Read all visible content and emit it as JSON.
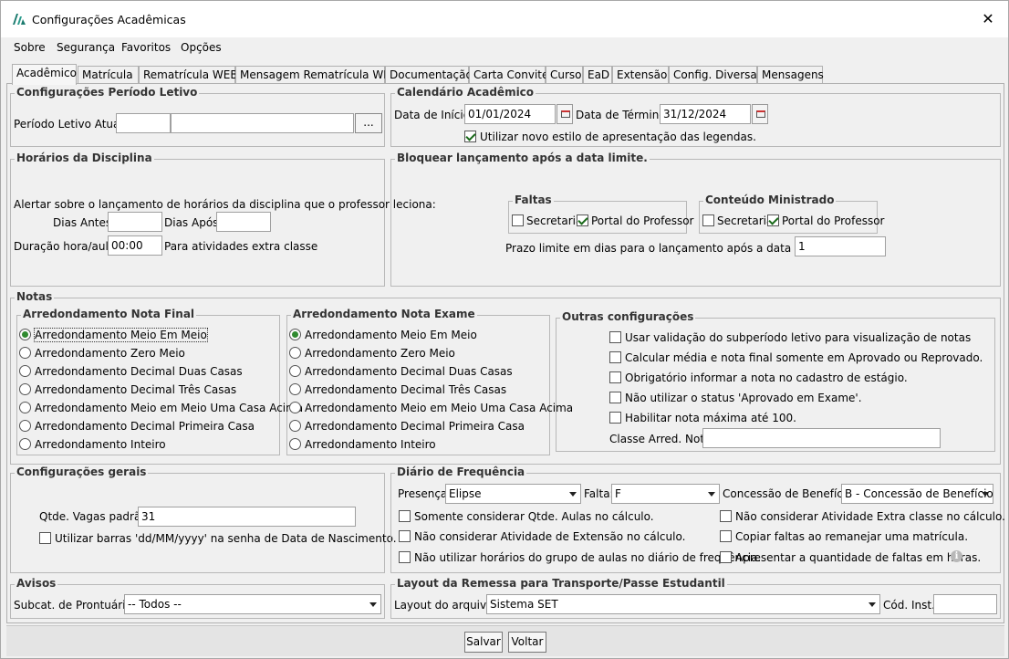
{
  "window": {
    "title": "Configurações Acadêmicas",
    "logo_icon": "app-logo-icon",
    "close_icon": "close-icon"
  },
  "menu": [
    "Sobre",
    "Segurança",
    "Favoritos",
    "Opções"
  ],
  "tabs": [
    "Acadêmico",
    "Matrícula",
    "Rematrícula WEB",
    "Mensagem Rematrícula WEB",
    "Documentação",
    "Carta Convite",
    "Curso",
    "EaD",
    "Extensão",
    "Config. Diversas",
    "Mensagens"
  ],
  "active_tab": "Acadêmico",
  "periodo": {
    "legend": "Configurações Período Letivo",
    "label": "Período Letivo Atual:",
    "code": "",
    "name": "",
    "browse": "..."
  },
  "calendario": {
    "legend": "Calendário Acadêmico",
    "inicio_label": "Data de Início:",
    "inicio": "01/01/2024",
    "termino_label": "Data de Término:",
    "termino": "31/12/2024",
    "novo_estilo": "Utilizar novo estilo de apresentação das legendas.",
    "novo_estilo_checked": true
  },
  "horarios": {
    "legend": "Horários da Disciplina",
    "alert": "Alertar sobre o lançamento de horários da disciplina que o professor leciona:",
    "dias_antes_label": "Dias Antes:",
    "dias_antes": "",
    "dias_apos_label": "Dias Após:",
    "dias_apos": "",
    "duracao_label": "Duração hora/aula:",
    "duracao": "00:00",
    "extra": "Para atividades extra classe"
  },
  "bloquear": {
    "legend": "Bloquear lançamento após a data limite.",
    "faltas_legend": "Faltas",
    "conteudo_legend": "Conteúdo Ministrado",
    "secretaria": "Secretaria",
    "portal": "Portal do Professor",
    "faltas_secretaria": false,
    "faltas_portal": true,
    "conteudo_secretaria": false,
    "conteudo_portal": true,
    "prazo_label": "Prazo limite em dias para o lançamento após a data da aula:",
    "prazo": "1"
  },
  "notas": {
    "legend": "Notas",
    "final_legend": "Arredondamento Nota Final",
    "exame_legend": "Arredondamento Nota Exame",
    "options": [
      "Arredondamento Meio Em Meio",
      "Arredondamento Zero Meio",
      "Arredondamento Decimal Duas Casas",
      "Arredondamento Decimal Três Casas",
      "Arredondamento Meio em Meio Uma Casa Acima",
      "Arredondamento Decimal Primeira Casa",
      "Arredondamento Inteiro"
    ],
    "final_selected": 0,
    "exame_selected": 0,
    "outras_legend": "Outras configurações",
    "outras": [
      "Usar validação do subperíodo letivo para visualização de notas",
      "Calcular média e nota final somente em Aprovado ou Reprovado.",
      "Obrigatório informar a nota no cadastro de estágio.",
      "Não utilizar o status 'Aprovado em Exame'.",
      "Habilitar nota máxima até 100."
    ],
    "classe_label": "Classe Arred. Nota:",
    "classe": ""
  },
  "gerais": {
    "legend": "Configurações gerais",
    "vagas_label": "Qtde. Vagas padrão:",
    "vagas": "31",
    "barras": "Utilizar barras 'dd/MM/yyyy' na senha de Data de Nascimento."
  },
  "diario": {
    "legend": "Diário de Frequência",
    "presenca_label": "Presença:",
    "presenca": "Elipse",
    "falta_label": "Falta:",
    "falta": "F",
    "concessao_label": "Concessão de Benefício:",
    "concessao": "B - Concessão de Benefício",
    "checks_left": [
      "Somente considerar Qtde. Aulas no cálculo.",
      "Não considerar Atividade de Extensão no cálculo.",
      "Não utilizar horários do grupo de aulas no diário de frequência."
    ],
    "checks_right": [
      "Não considerar Atividade Extra classe no cálculo.",
      "Copiar faltas ao remanejar uma matrícula.",
      "Apresentar a quantidade de faltas em horas."
    ],
    "info_icon": "info-icon"
  },
  "avisos": {
    "legend": "Avisos",
    "subcat_label": "Subcat. de Prontuário:",
    "subcat": "-- Todos --"
  },
  "layout": {
    "legend": "Layout da Remessa para Transporte/Passe Estudantil",
    "arquivo_label": "Layout do arquivo:",
    "arquivo": "Sistema SET",
    "cod_label": "Cód. Inst.:",
    "cod": ""
  },
  "footer": {
    "salvar": "Salvar",
    "voltar": "Voltar"
  }
}
